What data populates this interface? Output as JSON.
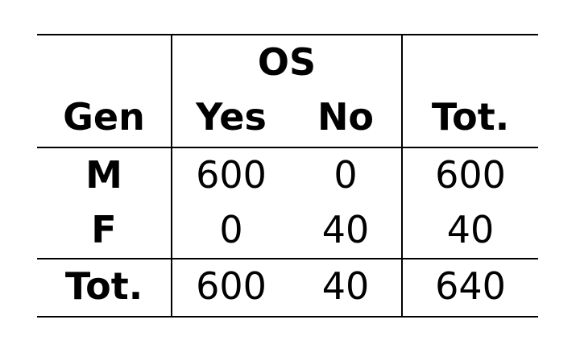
{
  "table": {
    "group_header": "OS",
    "headers": {
      "gender": "Gen",
      "yes": "Yes",
      "no": "No",
      "total": "Tot."
    },
    "rows": [
      {
        "label": "M",
        "yes": "600",
        "no": "0",
        "total": "600"
      },
      {
        "label": "F",
        "yes": "0",
        "no": "40",
        "total": "40"
      },
      {
        "label": "Tot.",
        "yes": "600",
        "no": "40",
        "total": "640"
      }
    ]
  }
}
